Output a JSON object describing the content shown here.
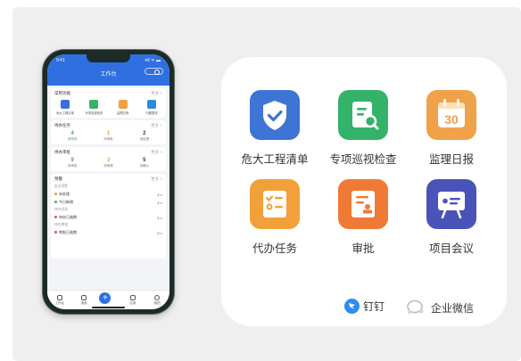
{
  "phone": {
    "status": {
      "time": "9:41",
      "signal": "•ıll ᯤ ▬"
    },
    "title": "工作台",
    "common": {
      "title": "常用功能",
      "more": "更多 >",
      "items": [
        {
          "label": "危大工程清单",
          "color": "#3b6fd8"
        },
        {
          "label": "专项巡视检查",
          "color": "#36b36a"
        },
        {
          "label": "监理日报",
          "color": "#f0a040"
        },
        {
          "label": "问题整改",
          "color": "#2d8bd8"
        }
      ]
    },
    "todo": {
      "title": "待办任务",
      "more": "更多 >",
      "stats": [
        {
          "value": "4",
          "label": "待完成",
          "color": "#36b36a"
        },
        {
          "value": "1",
          "label": "待审批",
          "color": "#f0a040"
        },
        {
          "value": "2",
          "label": "待处理",
          "color": "#333333"
        }
      ]
    },
    "approval": {
      "title": "待办审批",
      "more": "更多 >",
      "stats": [
        {
          "value": "9",
          "label": "待审批",
          "color": "#36b36a"
        },
        {
          "value": "3",
          "label": "待审核",
          "color": "#f0a040"
        },
        {
          "value": "5",
          "label": "待确认",
          "color": "#333333"
        }
      ]
    },
    "warning": {
      "title": "预警",
      "more": "更多 >",
      "groups": [
        {
          "sub": "安全预警",
          "rows": [
            {
              "label": "未处理",
              "count": "2 >",
              "color": "#f0a040"
            },
            {
              "label": "今日新增",
              "count": "2 >",
              "color": "#36b36a"
            }
          ]
        },
        {
          "sub": "待办任务",
          "rows": [
            {
              "label": "待办已逾期",
              "count": "2 >",
              "color": "#e05050"
            }
          ]
        },
        {
          "sub": "待办审批",
          "rows": [
            {
              "label": "审批已逾期",
              "count": "2 >",
              "color": "#e05050"
            }
          ]
        }
      ]
    },
    "tabs": [
      {
        "label": "工作台"
      },
      {
        "label": "消息"
      },
      {
        "label": "+"
      },
      {
        "label": "应用"
      },
      {
        "label": "我的"
      }
    ]
  },
  "features": [
    {
      "label": "危大工程清单",
      "color": "#3e74d6",
      "icon": "shield-check-icon"
    },
    {
      "label": "专项巡视检查",
      "color": "#33b26a",
      "icon": "document-search-icon"
    },
    {
      "label": "监理日报",
      "color": "#f0a24a",
      "icon": "calendar-30-icon"
    },
    {
      "label": "代办任务",
      "color": "#f2a13a",
      "icon": "checklist-icon"
    },
    {
      "label": "审批",
      "color": "#ef7a35",
      "icon": "approval-stamp-icon"
    },
    {
      "label": "项目会议",
      "color": "#4a53b8",
      "icon": "presentation-icon"
    }
  ],
  "platforms": {
    "dingtalk": "钉钉",
    "wework": "企业微信"
  }
}
